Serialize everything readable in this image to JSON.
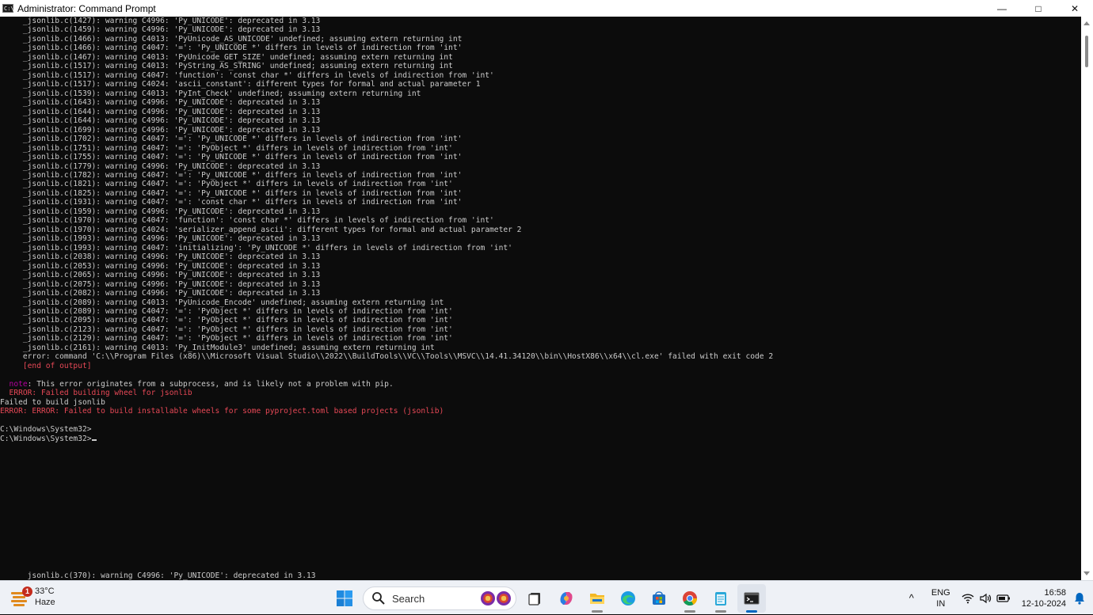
{
  "window": {
    "title": "Administrator: Command Prompt",
    "app_icon_text": "C:\\",
    "minimize_label": "—",
    "maximize_label": "□",
    "close_label": "✕"
  },
  "console": {
    "lines": [
      {
        "text": "     _jsonlib.c(1427): warning C4996: 'Py_UNICODE': deprecated in 3.13",
        "color": "default"
      },
      {
        "text": "     _jsonlib.c(1459): warning C4996: 'Py_UNICODE': deprecated in 3.13",
        "color": "default"
      },
      {
        "text": "     _jsonlib.c(1466): warning C4013: 'PyUnicode_AS_UNICODE' undefined; assuming extern returning int",
        "color": "default"
      },
      {
        "text": "     _jsonlib.c(1466): warning C4047: '=': 'Py_UNICODE *' differs in levels of indirection from 'int'",
        "color": "default"
      },
      {
        "text": "     _jsonlib.c(1467): warning C4013: 'PyUnicode_GET_SIZE' undefined; assuming extern returning int",
        "color": "default"
      },
      {
        "text": "     _jsonlib.c(1517): warning C4013: 'PyString_AS_STRING' undefined; assuming extern returning int",
        "color": "default"
      },
      {
        "text": "     _jsonlib.c(1517): warning C4047: 'function': 'const char *' differs in levels of indirection from 'int'",
        "color": "default"
      },
      {
        "text": "     _jsonlib.c(1517): warning C4024: 'ascii_constant': different types for formal and actual parameter 1",
        "color": "default"
      },
      {
        "text": "     _jsonlib.c(1539): warning C4013: 'PyInt_Check' undefined; assuming extern returning int",
        "color": "default"
      },
      {
        "text": "     _jsonlib.c(1643): warning C4996: 'Py_UNICODE': deprecated in 3.13",
        "color": "default"
      },
      {
        "text": "     _jsonlib.c(1644): warning C4996: 'Py_UNICODE': deprecated in 3.13",
        "color": "default"
      },
      {
        "text": "     _jsonlib.c(1644): warning C4996: 'Py_UNICODE': deprecated in 3.13",
        "color": "default"
      },
      {
        "text": "     _jsonlib.c(1699): warning C4996: 'Py_UNICODE': deprecated in 3.13",
        "color": "default"
      },
      {
        "text": "     _jsonlib.c(1702): warning C4047: '=': 'Py_UNICODE *' differs in levels of indirection from 'int'",
        "color": "default"
      },
      {
        "text": "     _jsonlib.c(1751): warning C4047: '=': 'PyObject *' differs in levels of indirection from 'int'",
        "color": "default"
      },
      {
        "text": "     _jsonlib.c(1755): warning C4047: '=': 'Py_UNICODE *' differs in levels of indirection from 'int'",
        "color": "default"
      },
      {
        "text": "     _jsonlib.c(1779): warning C4996: 'Py_UNICODE': deprecated in 3.13",
        "color": "default"
      },
      {
        "text": "     _jsonlib.c(1782): warning C4047: '=': 'Py_UNICODE *' differs in levels of indirection from 'int'",
        "color": "default"
      },
      {
        "text": "     _jsonlib.c(1821): warning C4047: '=': 'PyObject *' differs in levels of indirection from 'int'",
        "color": "default"
      },
      {
        "text": "     _jsonlib.c(1825): warning C4047: '=': 'Py_UNICODE *' differs in levels of indirection from 'int'",
        "color": "default"
      },
      {
        "text": "     _jsonlib.c(1931): warning C4047: '=': 'const char *' differs in levels of indirection from 'int'",
        "color": "default"
      },
      {
        "text": "     _jsonlib.c(1959): warning C4996: 'Py_UNICODE': deprecated in 3.13",
        "color": "default"
      },
      {
        "text": "     _jsonlib.c(1970): warning C4047: 'function': 'const char *' differs in levels of indirection from 'int'",
        "color": "default"
      },
      {
        "text": "     _jsonlib.c(1970): warning C4024: 'serializer_append_ascii': different types for formal and actual parameter 2",
        "color": "default"
      },
      {
        "text": "     _jsonlib.c(1993): warning C4996: 'Py_UNICODE': deprecated in 3.13",
        "color": "default"
      },
      {
        "text": "     _jsonlib.c(1993): warning C4047: 'initializing': 'Py_UNICODE *' differs in levels of indirection from 'int'",
        "color": "default"
      },
      {
        "text": "     _jsonlib.c(2038): warning C4996: 'Py_UNICODE': deprecated in 3.13",
        "color": "default"
      },
      {
        "text": "     _jsonlib.c(2053): warning C4996: 'Py_UNICODE': deprecated in 3.13",
        "color": "default"
      },
      {
        "text": "     _jsonlib.c(2065): warning C4996: 'Py_UNICODE': deprecated in 3.13",
        "color": "default"
      },
      {
        "text": "     _jsonlib.c(2075): warning C4996: 'Py_UNICODE': deprecated in 3.13",
        "color": "default"
      },
      {
        "text": "     _jsonlib.c(2082): warning C4996: 'Py_UNICODE': deprecated in 3.13",
        "color": "default"
      },
      {
        "text": "     _jsonlib.c(2089): warning C4013: 'PyUnicode_Encode' undefined; assuming extern returning int",
        "color": "default"
      },
      {
        "text": "     _jsonlib.c(2089): warning C4047: '=': 'PyObject *' differs in levels of indirection from 'int'",
        "color": "default"
      },
      {
        "text": "     _jsonlib.c(2095): warning C4047: '=': 'PyObject *' differs in levels of indirection from 'int'",
        "color": "default"
      },
      {
        "text": "     _jsonlib.c(2123): warning C4047: '=': 'PyObject *' differs in levels of indirection from 'int'",
        "color": "default"
      },
      {
        "text": "     _jsonlib.c(2129): warning C4047: '=': 'PyObject *' differs in levels of indirection from 'int'",
        "color": "default"
      },
      {
        "text": "     _jsonlib.c(2161): warning C4013: 'Py_InitModule3' undefined; assuming extern returning int",
        "color": "default"
      },
      {
        "text": "     error: command 'C:\\\\Program Files (x86)\\\\Microsoft Visual Studio\\\\2022\\\\BuildTools\\\\VC\\\\Tools\\\\MSVC\\\\14.41.34120\\\\bin\\\\HostX86\\\\x64\\\\cl.exe' failed with exit code 2",
        "color": "default"
      },
      {
        "text": "     [end of output]",
        "color": "red"
      },
      {
        "text": "",
        "color": "default"
      },
      {
        "segments": [
          {
            "text": "  note",
            "color": "magenta"
          },
          {
            "text": ": This error originates from a subprocess, and is likely not a problem with pip.",
            "color": "default"
          }
        ]
      },
      {
        "text": "  ERROR: Failed building wheel for jsonlib",
        "color": "red"
      },
      {
        "text": "Failed to build jsonlib",
        "color": "default"
      },
      {
        "text": "ERROR: ERROR: Failed to build installable wheels for some pyproject.toml based projects (jsonlib)",
        "color": "red"
      },
      {
        "text": "",
        "color": "default"
      },
      {
        "text": "C:\\Windows\\System32>",
        "color": "default"
      },
      {
        "text": "C:\\Windows\\System32>",
        "color": "default",
        "cursor": true
      }
    ],
    "bottom_line": "      jsonlib.c(370): warning C4996: 'Py_UNICODE': deprecated in 3.13"
  },
  "taskbar": {
    "weather": {
      "temp": "33°C",
      "condition": "Haze",
      "badge": "1"
    },
    "search_placeholder": "Search",
    "tray": {
      "lang_top": "ENG",
      "lang_bottom": "IN",
      "time": "16:58",
      "date": "12-10-2024",
      "chevron": "^"
    }
  },
  "colors": {
    "console_bg": "#0c0c0c",
    "console_text": "#cccccc",
    "error_red": "#e74856",
    "note_magenta": "#b4009e",
    "taskbar_bg": "#eef1f6",
    "accent": "#0067c0"
  }
}
